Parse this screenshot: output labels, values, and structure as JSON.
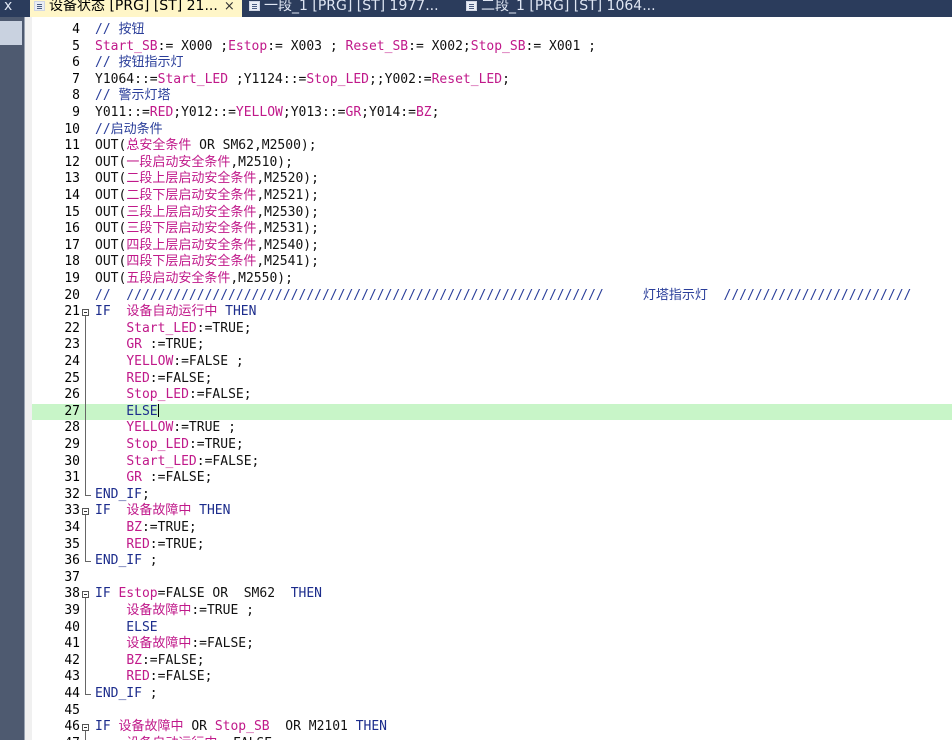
{
  "tabs": {
    "left_fragment": "x",
    "items": [
      {
        "label": "设备状态 [PRG] [ST] 21...",
        "close": "×"
      },
      {
        "label": "一段_1 [PRG] [ST] 1977..."
      },
      {
        "label": "二段_1 [PRG] [ST] 1064..."
      }
    ]
  },
  "editor": {
    "current_line": 27,
    "lines": [
      {
        "n": "4",
        "parts": [
          {
            "t": "// 按钮",
            "c": "cm"
          }
        ]
      },
      {
        "n": "5",
        "parts": [
          {
            "t": "Start_SB",
            "c": "var"
          },
          {
            "t": ":= X000 ;",
            "c": "pl"
          },
          {
            "t": "Estop",
            "c": "var"
          },
          {
            "t": ":= X003 ; ",
            "c": "pl"
          },
          {
            "t": "Reset_SB",
            "c": "var"
          },
          {
            "t": ":= X002;",
            "c": "pl"
          },
          {
            "t": "Stop_SB",
            "c": "var"
          },
          {
            "t": ":= X001 ;",
            "c": "pl"
          }
        ]
      },
      {
        "n": "6",
        "parts": [
          {
            "t": "// 按钮指示灯",
            "c": "cm"
          }
        ]
      },
      {
        "n": "7",
        "parts": [
          {
            "t": "Y1064::=",
            "c": "pl"
          },
          {
            "t": "Start_LED",
            "c": "var"
          },
          {
            "t": " ;Y1124::=",
            "c": "pl"
          },
          {
            "t": "Stop_LED",
            "c": "var"
          },
          {
            "t": ";;Y002:=",
            "c": "pl"
          },
          {
            "t": "Reset_LED",
            "c": "var"
          },
          {
            "t": ";",
            "c": "pl"
          }
        ]
      },
      {
        "n": "8",
        "parts": [
          {
            "t": "// 警示灯塔",
            "c": "cm"
          }
        ]
      },
      {
        "n": "9",
        "parts": [
          {
            "t": "Y011::=",
            "c": "pl"
          },
          {
            "t": "RED",
            "c": "var"
          },
          {
            "t": ";Y012::=",
            "c": "pl"
          },
          {
            "t": "YELLOW",
            "c": "var"
          },
          {
            "t": ";Y013::=",
            "c": "pl"
          },
          {
            "t": "GR",
            "c": "var"
          },
          {
            "t": ";Y014:=",
            "c": "pl"
          },
          {
            "t": "BZ",
            "c": "var"
          },
          {
            "t": ";",
            "c": "pl"
          }
        ]
      },
      {
        "n": "10",
        "parts": [
          {
            "t": "//启动条件",
            "c": "cm"
          }
        ]
      },
      {
        "n": "11",
        "parts": [
          {
            "t": "OUT(",
            "c": "pl"
          },
          {
            "t": "总安全条件",
            "c": "var"
          },
          {
            "t": " OR SM62,M2500);",
            "c": "pl"
          }
        ]
      },
      {
        "n": "12",
        "parts": [
          {
            "t": "OUT(",
            "c": "pl"
          },
          {
            "t": "一段启动安全条件",
            "c": "var"
          },
          {
            "t": ",M2510);",
            "c": "pl"
          }
        ]
      },
      {
        "n": "13",
        "parts": [
          {
            "t": "OUT(",
            "c": "pl"
          },
          {
            "t": "二段上层启动安全条件",
            "c": "var"
          },
          {
            "t": ",M2520);",
            "c": "pl"
          }
        ]
      },
      {
        "n": "14",
        "parts": [
          {
            "t": "OUT(",
            "c": "pl"
          },
          {
            "t": "二段下层启动安全条件",
            "c": "var"
          },
          {
            "t": ",M2521);",
            "c": "pl"
          }
        ]
      },
      {
        "n": "15",
        "parts": [
          {
            "t": "OUT(",
            "c": "pl"
          },
          {
            "t": "三段上层启动安全条件",
            "c": "var"
          },
          {
            "t": ",M2530);",
            "c": "pl"
          }
        ]
      },
      {
        "n": "16",
        "parts": [
          {
            "t": "OUT(",
            "c": "pl"
          },
          {
            "t": "三段下层启动安全条件",
            "c": "var"
          },
          {
            "t": ",M2531);",
            "c": "pl"
          }
        ]
      },
      {
        "n": "17",
        "parts": [
          {
            "t": "OUT(",
            "c": "pl"
          },
          {
            "t": "四段上层启动安全条件",
            "c": "var"
          },
          {
            "t": ",M2540);",
            "c": "pl"
          }
        ]
      },
      {
        "n": "18",
        "parts": [
          {
            "t": "OUT(",
            "c": "pl"
          },
          {
            "t": "四段下层启动安全条件",
            "c": "var"
          },
          {
            "t": ",M2541);",
            "c": "pl"
          }
        ]
      },
      {
        "n": "19",
        "parts": [
          {
            "t": "OUT(",
            "c": "pl"
          },
          {
            "t": "五段启动安全条件",
            "c": "var"
          },
          {
            "t": ",M2550);",
            "c": "pl"
          }
        ]
      },
      {
        "n": "20",
        "parts": [
          {
            "t": "//  /////////////////////////////////////////////////////////////     灯塔指示灯  ////////////////////////",
            "c": "cm"
          }
        ]
      },
      {
        "n": "21",
        "fold": "start",
        "parts": [
          {
            "t": "IF  ",
            "c": "kw"
          },
          {
            "t": "设备自动运行中",
            "c": "var"
          },
          {
            "t": " THEN",
            "c": "kw"
          }
        ]
      },
      {
        "n": "22",
        "parts": [
          {
            "t": "    ",
            "c": "pl"
          },
          {
            "t": "Start_LED",
            "c": "var"
          },
          {
            "t": ":=TRUE;",
            "c": "pl"
          }
        ]
      },
      {
        "n": "23",
        "parts": [
          {
            "t": "    ",
            "c": "pl"
          },
          {
            "t": "GR",
            "c": "var"
          },
          {
            "t": " :=TRUE;",
            "c": "pl"
          }
        ]
      },
      {
        "n": "24",
        "parts": [
          {
            "t": "    ",
            "c": "pl"
          },
          {
            "t": "YELLOW",
            "c": "var"
          },
          {
            "t": ":=FALSE ;",
            "c": "pl"
          }
        ]
      },
      {
        "n": "25",
        "parts": [
          {
            "t": "    ",
            "c": "pl"
          },
          {
            "t": "RED",
            "c": "var"
          },
          {
            "t": ":=FALSE;",
            "c": "pl"
          }
        ]
      },
      {
        "n": "26",
        "parts": [
          {
            "t": "    ",
            "c": "pl"
          },
          {
            "t": "Stop_LED",
            "c": "var"
          },
          {
            "t": ":=FALSE;",
            "c": "pl"
          }
        ]
      },
      {
        "n": "27",
        "caret": true,
        "parts": [
          {
            "t": "    ELSE",
            "c": "kw"
          }
        ]
      },
      {
        "n": "28",
        "parts": [
          {
            "t": "    ",
            "c": "pl"
          },
          {
            "t": "YELLOW",
            "c": "var"
          },
          {
            "t": ":=TRUE ;",
            "c": "pl"
          }
        ]
      },
      {
        "n": "29",
        "parts": [
          {
            "t": "    ",
            "c": "pl"
          },
          {
            "t": "Stop_LED",
            "c": "var"
          },
          {
            "t": ":=TRUE;",
            "c": "pl"
          }
        ]
      },
      {
        "n": "30",
        "parts": [
          {
            "t": "    ",
            "c": "pl"
          },
          {
            "t": "Start_LED",
            "c": "var"
          },
          {
            "t": ":=FALSE;",
            "c": "pl"
          }
        ]
      },
      {
        "n": "31",
        "parts": [
          {
            "t": "    ",
            "c": "pl"
          },
          {
            "t": "GR",
            "c": "var"
          },
          {
            "t": " :=FALSE;",
            "c": "pl"
          }
        ]
      },
      {
        "n": "32",
        "fold": "end",
        "parts": [
          {
            "t": "END_IF",
            "c": "kw"
          },
          {
            "t": ";",
            "c": "pl"
          }
        ]
      },
      {
        "n": "33",
        "fold": "start",
        "parts": [
          {
            "t": "IF  ",
            "c": "kw"
          },
          {
            "t": "设备故障中",
            "c": "var"
          },
          {
            "t": " THEN",
            "c": "kw"
          }
        ]
      },
      {
        "n": "34",
        "parts": [
          {
            "t": "    ",
            "c": "pl"
          },
          {
            "t": "BZ",
            "c": "var"
          },
          {
            "t": ":=TRUE;",
            "c": "pl"
          }
        ]
      },
      {
        "n": "35",
        "parts": [
          {
            "t": "    ",
            "c": "pl"
          },
          {
            "t": "RED",
            "c": "var"
          },
          {
            "t": ":=TRUE;",
            "c": "pl"
          }
        ]
      },
      {
        "n": "36",
        "fold": "end",
        "parts": [
          {
            "t": "END_IF",
            "c": "kw"
          },
          {
            "t": " ;",
            "c": "pl"
          }
        ]
      },
      {
        "n": "37",
        "parts": []
      },
      {
        "n": "38",
        "fold": "start",
        "parts": [
          {
            "t": "IF ",
            "c": "kw"
          },
          {
            "t": "Estop",
            "c": "var"
          },
          {
            "t": "=FALSE OR  SM62  ",
            "c": "pl"
          },
          {
            "t": "THEN",
            "c": "kw"
          }
        ]
      },
      {
        "n": "39",
        "parts": [
          {
            "t": "    ",
            "c": "pl"
          },
          {
            "t": "设备故障中",
            "c": "var"
          },
          {
            "t": ":=TRUE ;",
            "c": "pl"
          }
        ]
      },
      {
        "n": "40",
        "parts": [
          {
            "t": "    ELSE",
            "c": "kw"
          }
        ]
      },
      {
        "n": "41",
        "parts": [
          {
            "t": "    ",
            "c": "pl"
          },
          {
            "t": "设备故障中",
            "c": "var"
          },
          {
            "t": ":=FALSE;",
            "c": "pl"
          }
        ]
      },
      {
        "n": "42",
        "parts": [
          {
            "t": "    ",
            "c": "pl"
          },
          {
            "t": "BZ",
            "c": "var"
          },
          {
            "t": ":=FALSE;",
            "c": "pl"
          }
        ]
      },
      {
        "n": "43",
        "parts": [
          {
            "t": "    ",
            "c": "pl"
          },
          {
            "t": "RED",
            "c": "var"
          },
          {
            "t": ":=FALSE;",
            "c": "pl"
          }
        ]
      },
      {
        "n": "44",
        "fold": "end",
        "parts": [
          {
            "t": "END_IF",
            "c": "kw"
          },
          {
            "t": " ;",
            "c": "pl"
          }
        ]
      },
      {
        "n": "45",
        "parts": []
      },
      {
        "n": "46",
        "fold": "start",
        "parts": [
          {
            "t": "IF ",
            "c": "kw"
          },
          {
            "t": "设备故障中",
            "c": "var"
          },
          {
            "t": " OR ",
            "c": "pl"
          },
          {
            "t": "Stop_SB",
            "c": "var"
          },
          {
            "t": "  OR M2101 ",
            "c": "pl"
          },
          {
            "t": "THEN",
            "c": "kw"
          }
        ]
      },
      {
        "n": "47",
        "parts": [
          {
            "t": "    ",
            "c": "pl"
          },
          {
            "t": "设备自动运行中",
            "c": "var"
          },
          {
            "t": ":=FALSE",
            "c": "pl"
          }
        ]
      }
    ]
  }
}
